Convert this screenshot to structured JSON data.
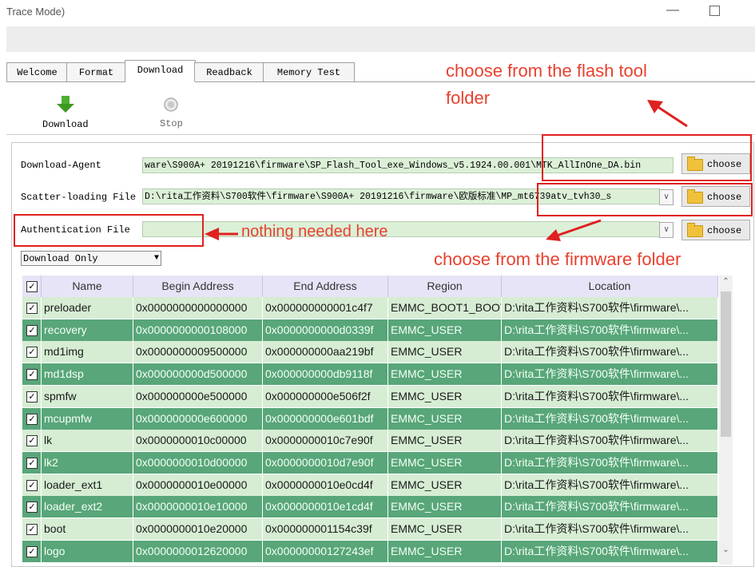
{
  "window": {
    "title": "Trace Mode)",
    "min_glyph": "—"
  },
  "tabs": [
    "Welcome",
    "Format",
    "Download",
    "Readback",
    "Memory Test"
  ],
  "toolbar": {
    "download_label": "Download",
    "stop_label": "Stop"
  },
  "form": {
    "download_agent": {
      "label": "Download-Agent",
      "value": "ware\\S900A+ 20191216\\firmware\\SP_Flash_Tool_exe_Windows_v5.1924.00.001\\MTK_AllInOne_DA.bin"
    },
    "scatter": {
      "label": "Scatter-loading File",
      "value": "D:\\rita工作资料\\S700软件\\firmware\\S900A+ 20191216\\firmware\\欧版标准\\MP_mt6739atv_tvh30_s"
    },
    "auth": {
      "label": "Authentication File",
      "value": ""
    },
    "choose_label": "choose",
    "mode_select": "Download Only"
  },
  "table": {
    "columns": [
      "Name",
      "Begin Address",
      "End Address",
      "Region",
      "Location"
    ],
    "rows": [
      {
        "name": "preloader",
        "begin": "0x0000000000000000",
        "end": "0x000000000001c4f7",
        "region": "EMMC_BOOT1_BOOT2",
        "location": "D:\\rita工作资料\\S700软件\\firmware\\..."
      },
      {
        "name": "recovery",
        "begin": "0x0000000000108000",
        "end": "0x0000000000d0339f",
        "region": "EMMC_USER",
        "location": "D:\\rita工作资料\\S700软件\\firmware\\..."
      },
      {
        "name": "md1img",
        "begin": "0x0000000009500000",
        "end": "0x000000000aa219bf",
        "region": "EMMC_USER",
        "location": "D:\\rita工作资料\\S700软件\\firmware\\..."
      },
      {
        "name": "md1dsp",
        "begin": "0x000000000d500000",
        "end": "0x000000000db9118f",
        "region": "EMMC_USER",
        "location": "D:\\rita工作资料\\S700软件\\firmware\\..."
      },
      {
        "name": "spmfw",
        "begin": "0x000000000e500000",
        "end": "0x000000000e506f2f",
        "region": "EMMC_USER",
        "location": "D:\\rita工作资料\\S700软件\\firmware\\..."
      },
      {
        "name": "mcupmfw",
        "begin": "0x000000000e600000",
        "end": "0x000000000e601bdf",
        "region": "EMMC_USER",
        "location": "D:\\rita工作资料\\S700软件\\firmware\\..."
      },
      {
        "name": "lk",
        "begin": "0x0000000010c00000",
        "end": "0x0000000010c7e90f",
        "region": "EMMC_USER",
        "location": "D:\\rita工作资料\\S700软件\\firmware\\..."
      },
      {
        "name": "lk2",
        "begin": "0x0000000010d00000",
        "end": "0x0000000010d7e90f",
        "region": "EMMC_USER",
        "location": "D:\\rita工作资料\\S700软件\\firmware\\..."
      },
      {
        "name": "loader_ext1",
        "begin": "0x0000000010e00000",
        "end": "0x0000000010e0cd4f",
        "region": "EMMC_USER",
        "location": "D:\\rita工作资料\\S700软件\\firmware\\..."
      },
      {
        "name": "loader_ext2",
        "begin": "0x0000000010e10000",
        "end": "0x0000000010e1cd4f",
        "region": "EMMC_USER",
        "location": "D:\\rita工作资料\\S700软件\\firmware\\..."
      },
      {
        "name": "boot",
        "begin": "0x0000000010e20000",
        "end": "0x000000001154c39f",
        "region": "EMMC_USER",
        "location": "D:\\rita工作资料\\S700软件\\firmware\\..."
      },
      {
        "name": "logo",
        "begin": "0x0000000012620000",
        "end": "0x00000000127243ef",
        "region": "EMMC_USER",
        "location": "D:\\rita工作资料\\S700软件\\firmware\\..."
      }
    ]
  },
  "annotations": {
    "flash_tool_line1": "choose from the flash tool",
    "flash_tool_line2": "folder",
    "nothing_needed": "nothing needed here",
    "firmware_folder": "choose from the firmware folder"
  },
  "colors": {
    "annotation": "#e02020",
    "row_light": "#d6edd4",
    "row_dark": "#58a679",
    "header": "#e7e4f7",
    "field": "#dcf0d8"
  }
}
